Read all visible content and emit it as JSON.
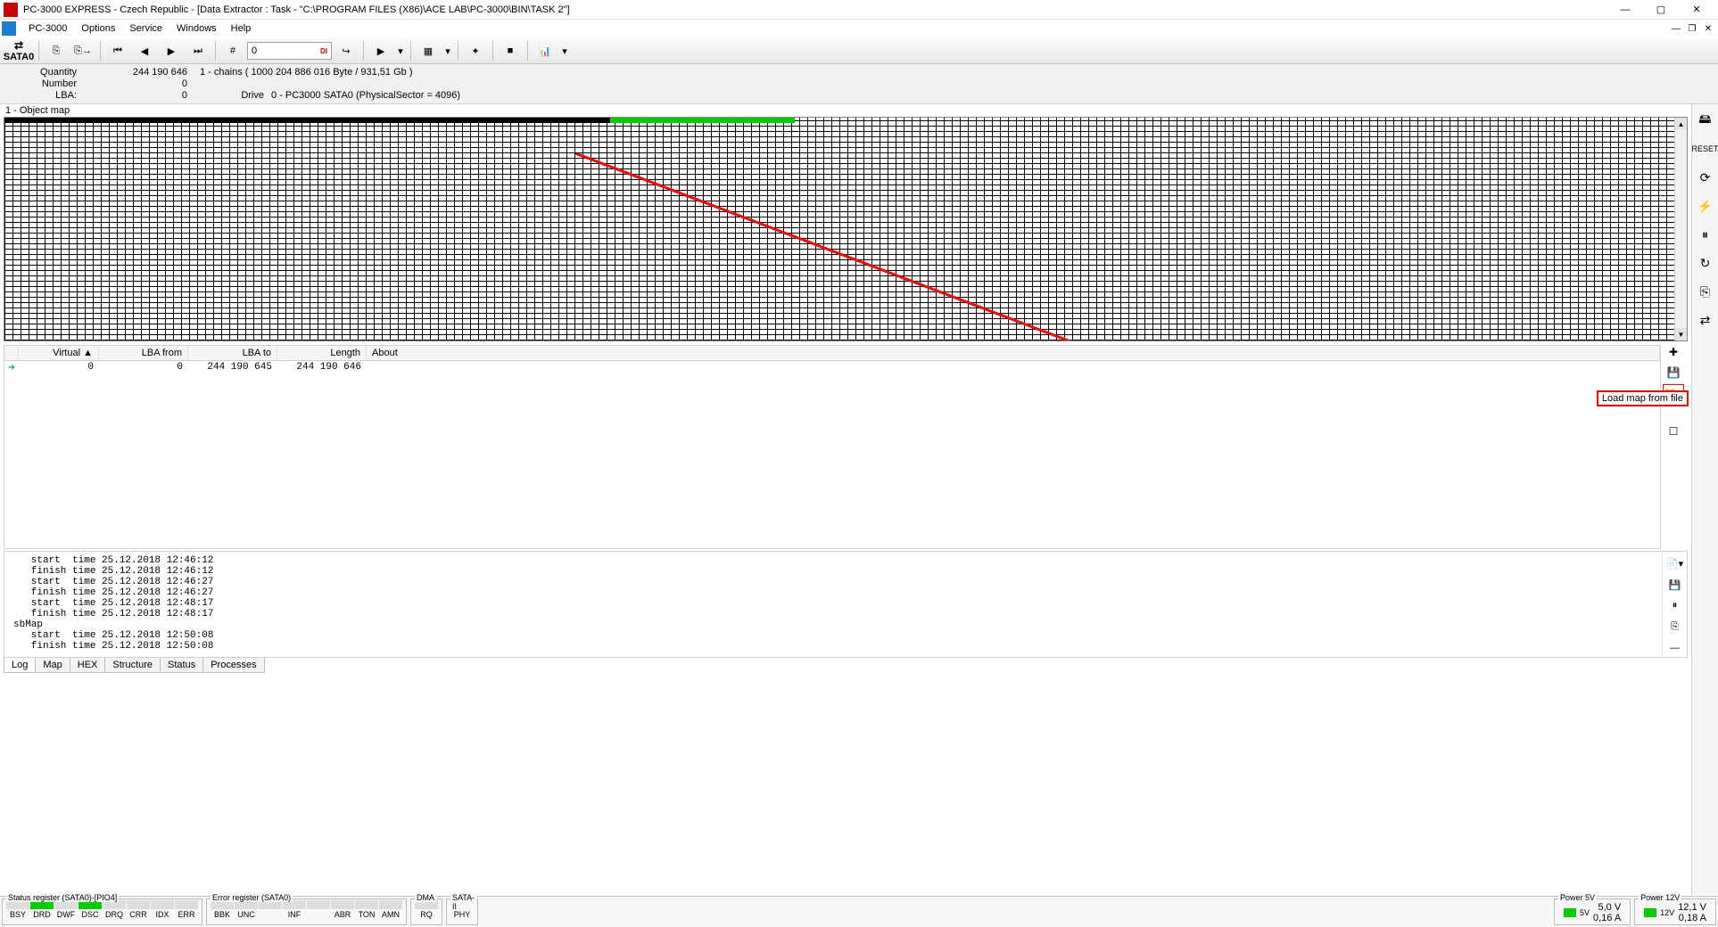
{
  "window": {
    "title": "PC-3000 EXPRESS - Czech Republic - [Data Extractor : Task - \"C:\\PROGRAM FILES (X86)\\ACE LAB\\PC-3000\\BIN\\TASK 2\"]"
  },
  "menu": {
    "items": [
      "PC-3000",
      "Options",
      "Service",
      "Windows",
      "Help"
    ]
  },
  "toolbar": {
    "sata": "SATA0",
    "lba_value": "0",
    "lba_flag": "DI"
  },
  "info": {
    "quantity_lbl": "Quantity",
    "quantity": "244 190 646",
    "chains": "1 - chains  ( 1000 204 886 016 Byte /  931,51 Gb )",
    "number_lbl": "Number",
    "number": "0",
    "lba_lbl": "LBA:",
    "lba": "0",
    "drive_lbl": "Drive",
    "drive": "0 - PC3000 SATA0 (PhysicalSector = 4096)"
  },
  "objmap": {
    "caption": "1 - Object map"
  },
  "table": {
    "headers": [
      "Virtual",
      "LBA from",
      "LBA to",
      "Length",
      "About"
    ],
    "row": {
      "virtual": "0",
      "lba_from": "0",
      "lba_to": "244 190 645",
      "length": "244 190 646",
      "about": ""
    }
  },
  "tooltip": {
    "text": "Load map from file"
  },
  "log": {
    "lines": [
      "   start  time 25.12.2018 12:46:12",
      "   finish time 25.12.2018 12:46:12",
      "   start  time 25.12.2018 12:46:27",
      "   finish time 25.12.2018 12:46:27",
      "   start  time 25.12.2018 12:48:17",
      "   finish time 25.12.2018 12:48:17",
      "sbMap",
      "   start  time 25.12.2018 12:50:08",
      "   finish time 25.12.2018 12:50:08"
    ]
  },
  "tabs": [
    "Log",
    "Map",
    "HEX",
    "Structure",
    "Status",
    "Processes"
  ],
  "status": {
    "reg_title": "Status register (SATA0)-[PIO4]",
    "err_title": "Error register (SATA0)",
    "dma_title": "DMA",
    "sata_title": "SATA-II",
    "reg": [
      {
        "t": "BSY",
        "on": false
      },
      {
        "t": "DRD",
        "on": true
      },
      {
        "t": "DWF",
        "on": false
      },
      {
        "t": "DSC",
        "on": true
      },
      {
        "t": "DRQ",
        "on": false
      },
      {
        "t": "CRR",
        "on": false
      },
      {
        "t": "IDX",
        "on": false
      },
      {
        "t": "ERR",
        "on": false
      }
    ],
    "err": [
      {
        "t": "BBK",
        "on": false
      },
      {
        "t": "UNC",
        "on": false
      },
      {
        "t": "",
        "on": false
      },
      {
        "t": "INF",
        "on": false
      },
      {
        "t": "",
        "on": false
      },
      {
        "t": "ABR",
        "on": false
      },
      {
        "t": "TON",
        "on": false
      },
      {
        "t": "AMN",
        "on": false
      }
    ],
    "dma": [
      {
        "t": "RQ",
        "on": false
      }
    ],
    "sata": [
      {
        "t": "PHY",
        "on": true
      }
    ],
    "p5": {
      "title": "Power 5V",
      "lbl": "5V",
      "v": "5,0 V",
      "a": "0,16 A"
    },
    "p12": {
      "title": "Power 12V",
      "lbl": "12V",
      "v": "12,1 V",
      "a": "0,18 A"
    }
  }
}
